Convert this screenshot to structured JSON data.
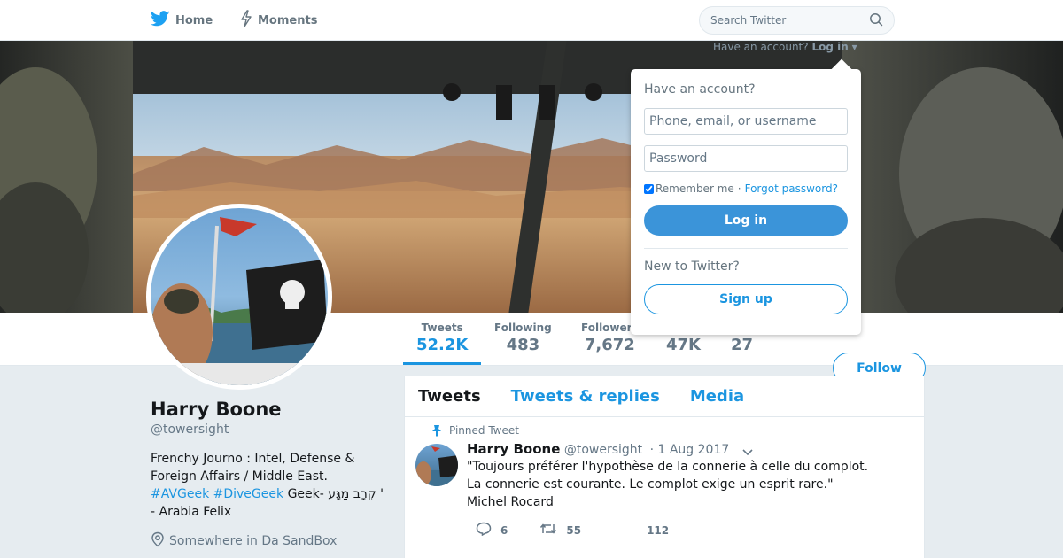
{
  "topnav": {
    "home_label": "Home",
    "moments_label": "Moments",
    "search_placeholder": "Search Twitter"
  },
  "banner_hint": {
    "prefix": "Have an account?",
    "link": "Log in"
  },
  "login": {
    "title": "Have an account?",
    "username_placeholder": "Phone, email, or username",
    "password_placeholder": "Password",
    "remember": "Remember me",
    "separator": "·",
    "forgot": "Forgot password?",
    "login_button": "Log in",
    "new_title": "New to Twitter?",
    "signup_button": "Sign up"
  },
  "stats": [
    {
      "label": "Tweets",
      "value": "52.2K"
    },
    {
      "label": "Following",
      "value": "483"
    },
    {
      "label": "Followers",
      "value": "7,672"
    },
    {
      "label": "",
      "value": "47K"
    },
    {
      "label": "",
      "value": "27"
    }
  ],
  "follow_button": "Follow",
  "profile": {
    "name": "Harry Boone",
    "handle": "@towersight",
    "bio_part1": "Frenchy Journo : Intel, Defense & Foreign Affairs / Middle East.",
    "tag1": "#AVGeek",
    "tag2": "#DiveGeek",
    "bio_part2": "Geek- קְרָב מַגָּע ' - Arabia Felix",
    "location": "Somewhere in Da SandBox"
  },
  "timeline": {
    "tabs": [
      "Tweets",
      "Tweets & replies",
      "Media"
    ],
    "pinned_label": "Pinned Tweet",
    "tweet": {
      "name": "Harry Boone",
      "handle": "@towersight",
      "date": "· 1 Aug 2017",
      "text_line1": "\"Toujours préférer l'hypothèse de la connerie à celle du complot.",
      "text_line2": "La connerie est courante. Le complot exige un esprit rare.\"",
      "text_line3": "Michel Rocard",
      "replies": "6",
      "retweets": "55",
      "likes": "112"
    }
  },
  "colors": {
    "accent": "#1b95e0",
    "login_button": "#3b94d9",
    "background": "#e6ecf0"
  }
}
